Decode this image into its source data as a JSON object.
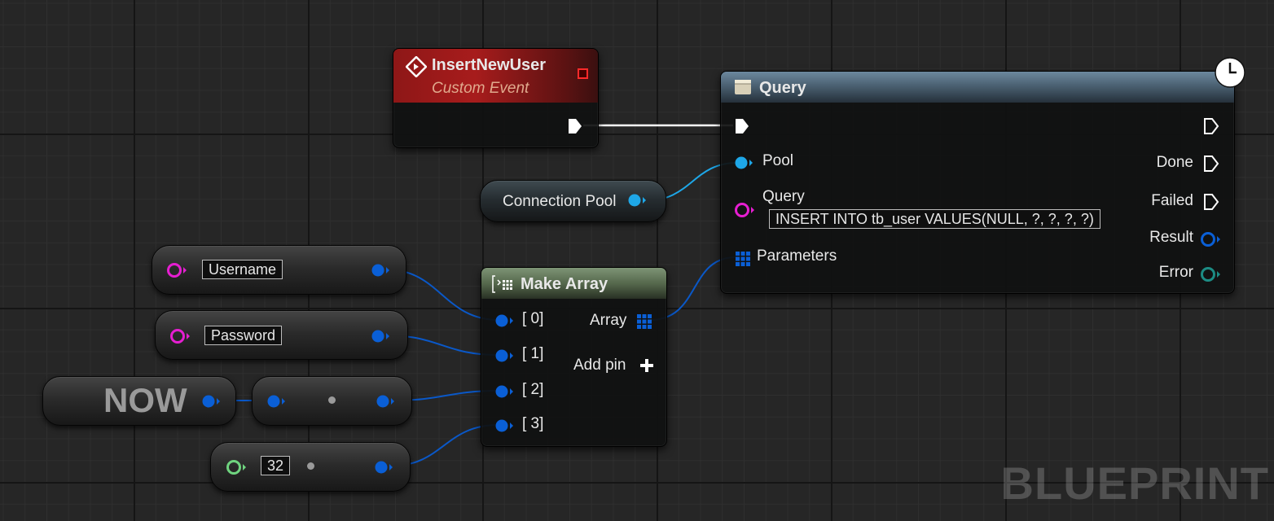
{
  "event_node": {
    "title": "InsertNewUser",
    "subtitle": "Custom Event"
  },
  "query_node": {
    "title": "Query",
    "inputs": {
      "pool": "Pool",
      "query": "Query",
      "parameters": "Parameters"
    },
    "query_value": "INSERT INTO tb_user VALUES(NULL, ?, ?, ?, ?)",
    "outputs": {
      "done": "Done",
      "failed": "Failed",
      "result": "Result",
      "error": "Error"
    }
  },
  "connection_pool_node": {
    "label": "Connection Pool"
  },
  "make_array_node": {
    "title": "Make Array",
    "inputs": [
      "[ 0]",
      "[ 1]",
      "[ 2]",
      "[ 3]"
    ],
    "output": "Array",
    "add_pin": "Add pin"
  },
  "literal_nodes": {
    "username": "Username",
    "password": "Password",
    "now": "NOW",
    "number": "32"
  },
  "watermark": "BLUEPRINT",
  "colors": {
    "object_pin": "#0a5fd6",
    "pool_pin": "#1ea7e8",
    "string_pin": "#e61ed1",
    "int_pin": "#6fd47f",
    "error_pin": "#1c8c84",
    "event_header": "#a21a1a",
    "query_header": "#52687a",
    "make_array_header": "#5c6f57",
    "wire": "#0a58c8"
  }
}
